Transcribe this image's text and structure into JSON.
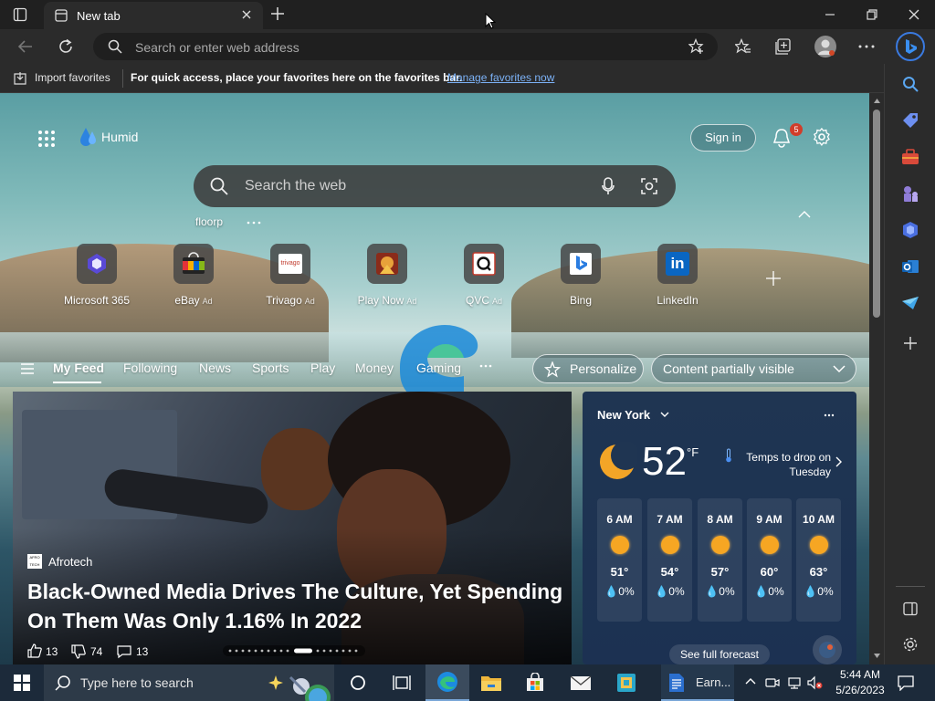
{
  "browser": {
    "tab_title": "New tab",
    "address_placeholder": "Search or enter web address"
  },
  "favorites_bar": {
    "import_label": "Import favorites",
    "hint": "For quick access, place your favorites here on the favorites bar.",
    "manage_link": "Manage favorites now"
  },
  "page": {
    "weather_brand": "Humid",
    "sign_in": "Sign in",
    "notification_count": "5",
    "search_placeholder": "Search the web",
    "recent_search": "floorp",
    "quick_links": [
      {
        "label": "Microsoft 365",
        "ad": ""
      },
      {
        "label": "eBay",
        "ad": "Ad"
      },
      {
        "label": "Trivago",
        "ad": "Ad",
        "logo_text": "trivago"
      },
      {
        "label": "Play Now",
        "ad": "Ad"
      },
      {
        "label": "QVC",
        "ad": "Ad"
      },
      {
        "label": "Bing",
        "ad": ""
      },
      {
        "label": "LinkedIn",
        "ad": "",
        "logo_text": "in"
      }
    ],
    "feed_nav": [
      "My Feed",
      "Following",
      "News",
      "Sports",
      "Play",
      "Money",
      "Gaming"
    ],
    "personalize": "Personalize",
    "content_visibility": "Content partially visible"
  },
  "news": {
    "source_badge": "AFRO TECH",
    "source": "Afrotech",
    "headline_line1": "Black-Owned Media Drives The Culture, Yet Spending",
    "headline_line2": "On Them Was Only 1.16% In 2022",
    "likes": "13",
    "dislikes": "74",
    "comments": "13"
  },
  "weather": {
    "location": "New York",
    "temp": "52",
    "unit": "°F",
    "alert_line1": "Temps to drop on",
    "alert_line2": "Tuesday",
    "hours": [
      {
        "time": "6 AM",
        "temp": "51°",
        "precip": "0%"
      },
      {
        "time": "7 AM",
        "temp": "54°",
        "precip": "0%"
      },
      {
        "time": "8 AM",
        "temp": "57°",
        "precip": "0%"
      },
      {
        "time": "9 AM",
        "temp": "60°",
        "precip": "0%"
      },
      {
        "time": "10 AM",
        "temp": "63°",
        "precip": "0%"
      }
    ],
    "forecast_link": "See full forecast"
  },
  "taskbar": {
    "search_placeholder": "Type here to search",
    "pinned_doc": "Earn...",
    "time": "5:44 AM",
    "date": "5/26/2023"
  }
}
